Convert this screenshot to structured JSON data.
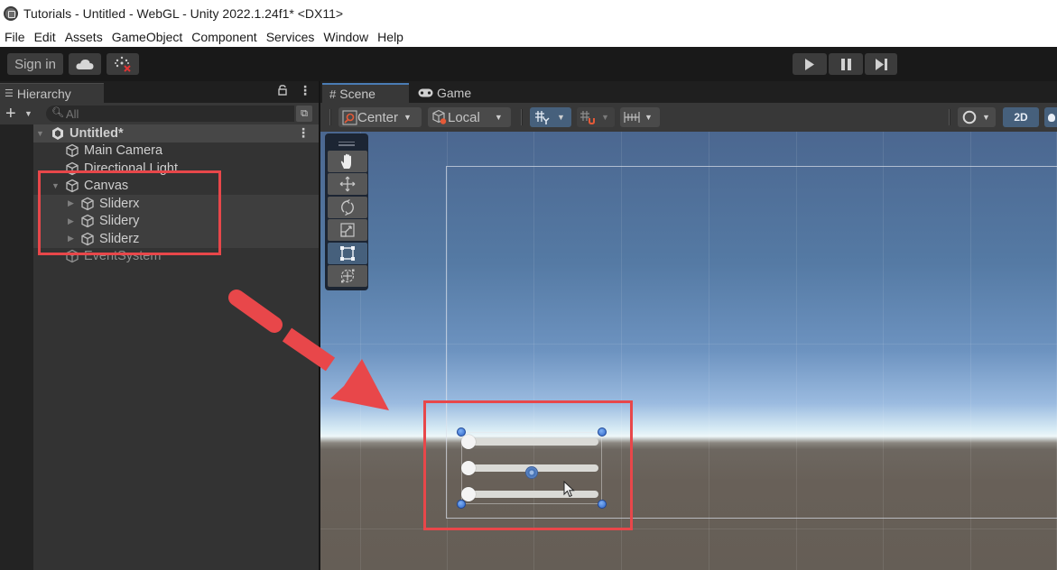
{
  "window": {
    "title": "Tutorials - Untitled - WebGL - Unity 2022.1.24f1* <DX11>"
  },
  "menu": [
    "File",
    "Edit",
    "Assets",
    "GameObject",
    "Component",
    "Services",
    "Window",
    "Help"
  ],
  "toolbar": {
    "sign_in": "Sign in",
    "cloud_icon": "cloud-icon",
    "collab_icon": "collab-icon",
    "play_icon": "play-icon",
    "pause_icon": "pause-icon",
    "step_icon": "step-icon"
  },
  "hierarchy": {
    "tab_label": "Hierarchy",
    "search_placeholder": "All",
    "scene_name": "Untitled*",
    "items": [
      {
        "label": "Main Camera",
        "depth": 1,
        "expandable": false
      },
      {
        "label": "Directional Light",
        "depth": 1,
        "expandable": false
      },
      {
        "label": "Canvas",
        "depth": 1,
        "expandable": true,
        "expanded": true
      },
      {
        "label": "Sliderx",
        "depth": 2,
        "expandable": true,
        "expanded": false
      },
      {
        "label": "Slidery",
        "depth": 2,
        "expandable": true,
        "expanded": false
      },
      {
        "label": "Sliderz",
        "depth": 2,
        "expandable": true,
        "expanded": false
      },
      {
        "label": "EventSystem",
        "depth": 1,
        "expandable": false
      }
    ]
  },
  "scene": {
    "tabs": [
      {
        "label": "Scene",
        "icon": "grid-icon",
        "active": true
      },
      {
        "label": "Game",
        "icon": "gamepad-icon",
        "active": false
      }
    ],
    "pivot_mode": "Center",
    "pivot_rotation": "Local",
    "mode_2d": "2D",
    "tools": [
      "hand-tool",
      "move-tool",
      "rotate-tool",
      "scale-tool",
      "rect-tool",
      "transform-tool"
    ],
    "active_tool": "rect-tool",
    "sliders": [
      {
        "name": "Sliderx",
        "value": 0.0
      },
      {
        "name": "Slidery",
        "value": 0.0
      },
      {
        "name": "Sliderz",
        "value": 0.0
      }
    ]
  },
  "annotations": {
    "color": "#e8474a"
  }
}
